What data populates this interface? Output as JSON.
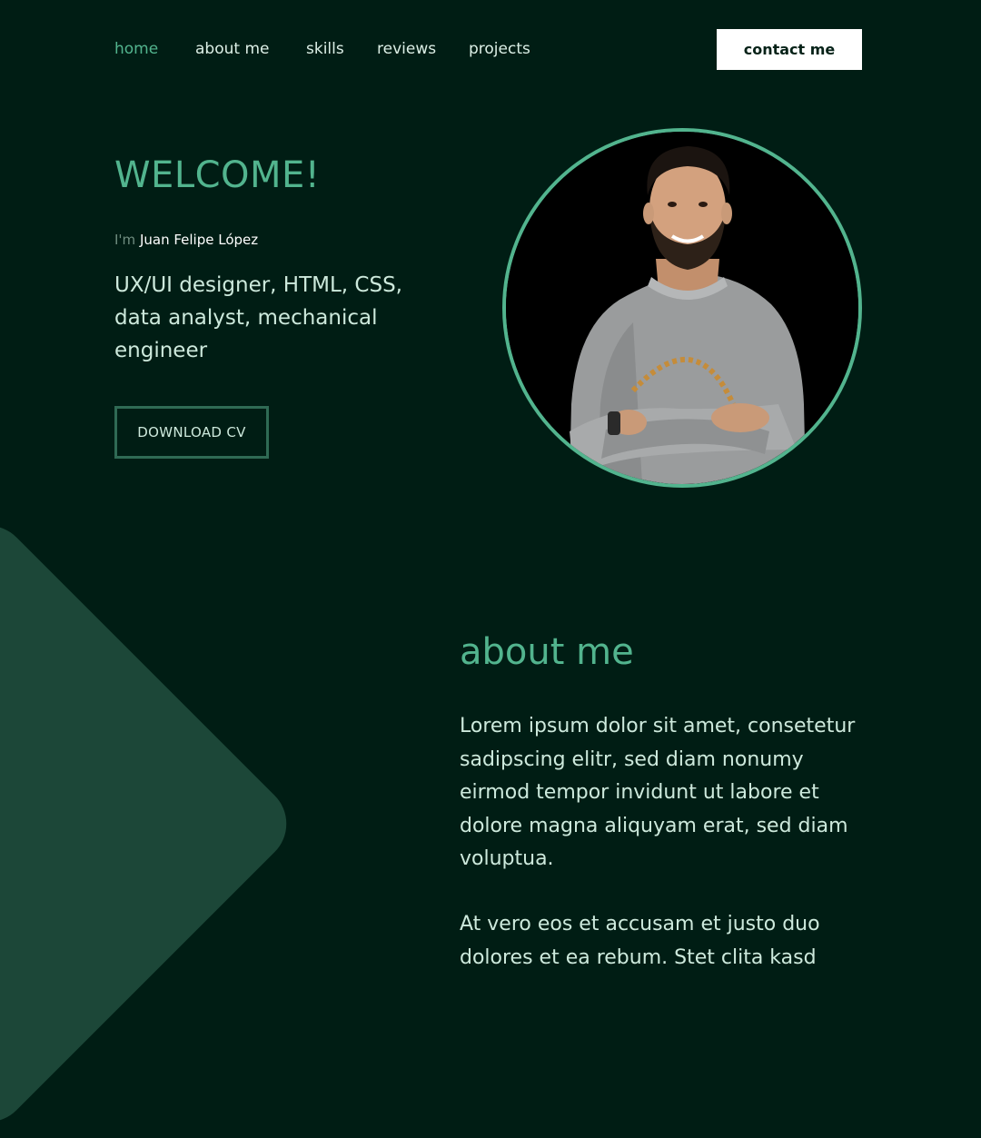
{
  "nav": {
    "items": [
      {
        "label": "home",
        "active": true
      },
      {
        "label": "about me",
        "active": false
      },
      {
        "label": "skills",
        "active": false
      },
      {
        "label": "reviews",
        "active": false
      },
      {
        "label": "projects",
        "active": false
      }
    ],
    "contact_label": "contact me"
  },
  "hero": {
    "welcome": "WELCOME!",
    "intro_prefix": "I'm",
    "name": "Juan Felipe López",
    "roles": "UX/UI designer, HTML, CSS, data analyst, mechanical engineer",
    "cv_button": "DOWNLOAD CV"
  },
  "about": {
    "title": "about me",
    "paragraph_1": "Lorem ipsum dolor sit amet, consetetur sadipscing elitr, sed diam nonumy eirmod tempor invidunt ut labore et dolore magna aliquyam erat, sed diam voluptua.",
    "paragraph_2": "At vero eos et accusam et justo duo dolores et ea rebum. Stet clita kasd"
  },
  "icons": {
    "portrait": "profile-photo"
  },
  "colors": {
    "background": "#001d14",
    "accent": "#52b48e",
    "text": "#cde9dc",
    "shape": "#1c4738",
    "button_bg": "#ffffff"
  }
}
